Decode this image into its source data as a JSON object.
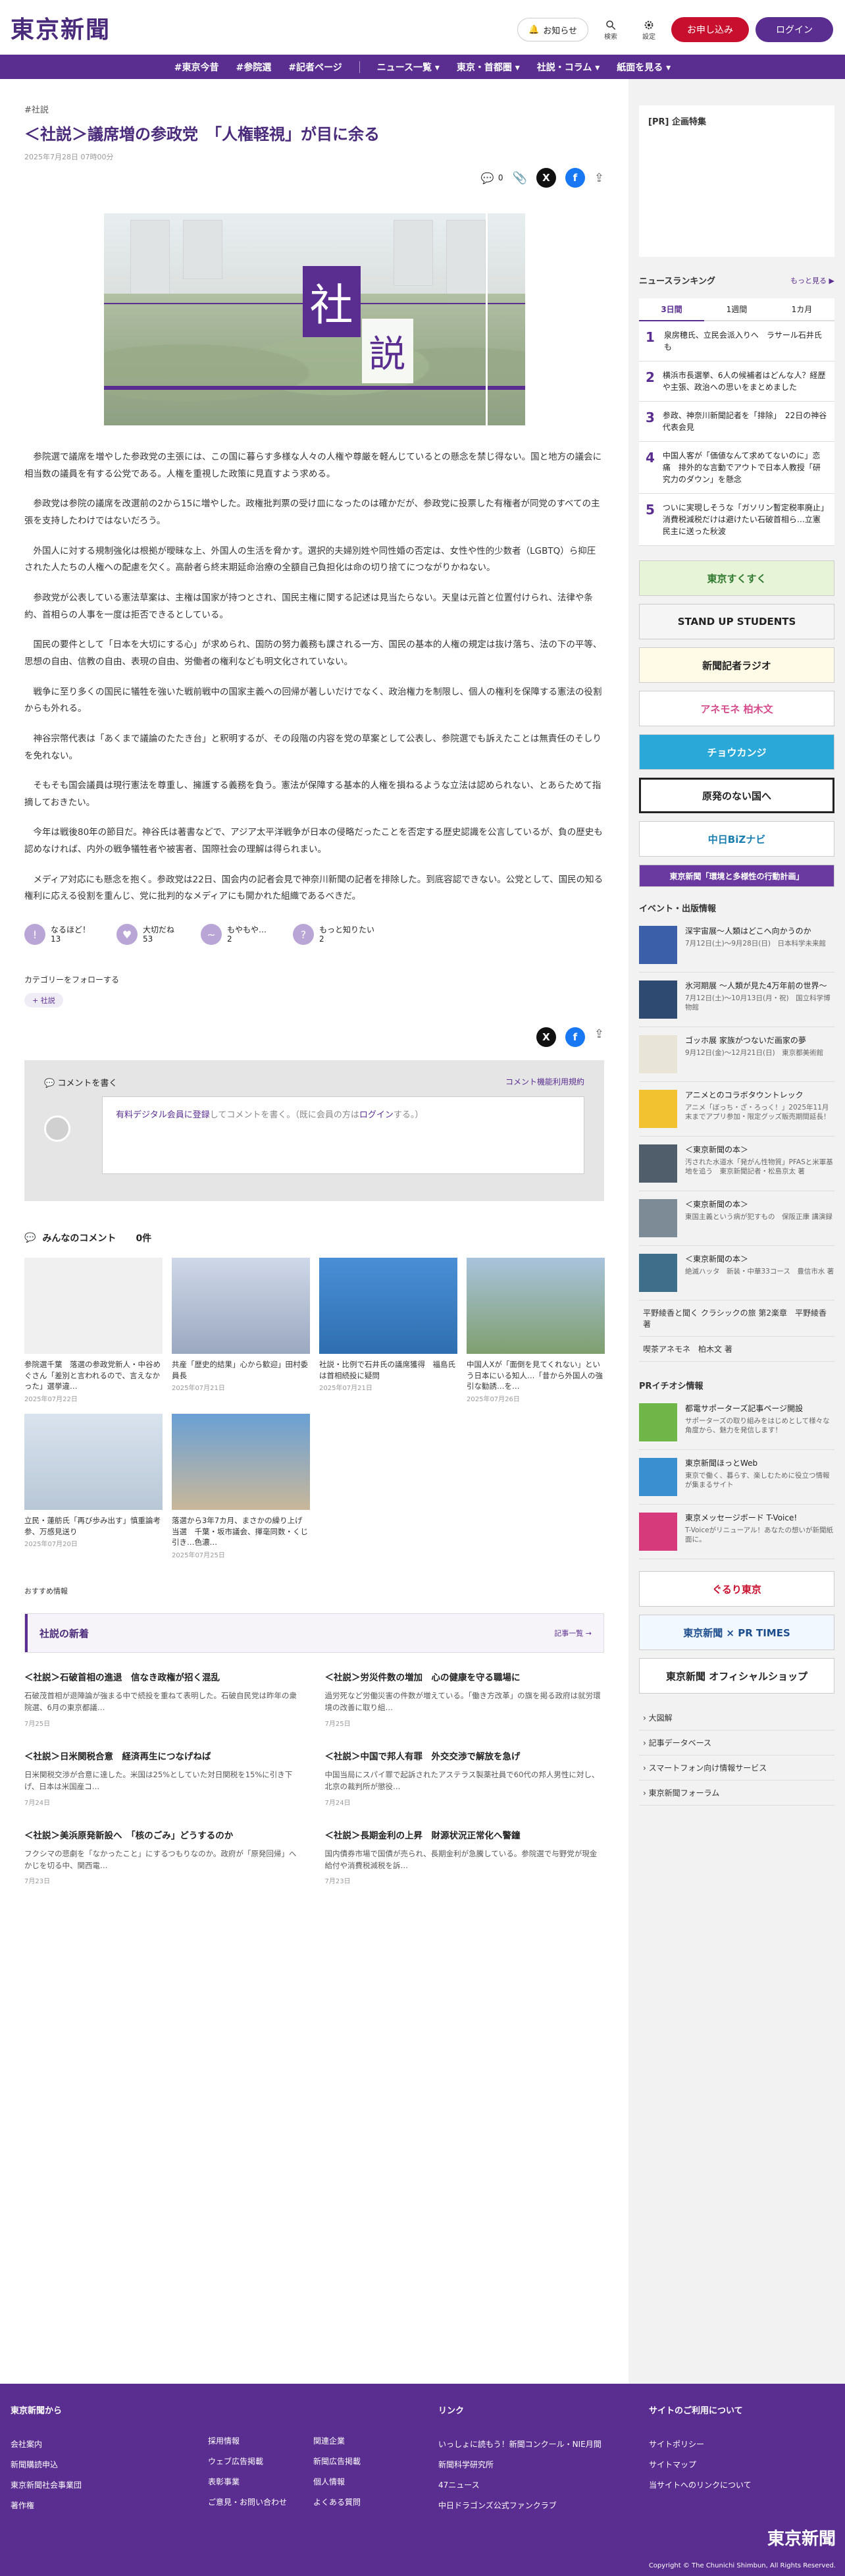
{
  "header": {
    "logo": "東京新聞",
    "notice": "お知らせ",
    "search": "検索",
    "settings": "設定",
    "apply": "お申し込み",
    "login": "ログイン"
  },
  "nav": [
    "#東京今昔",
    "#参院選",
    "#記者ページ",
    "ニュース一覧 ▾",
    "東京・首都圏 ▾",
    "社説・コラム ▾",
    "紙面を見る ▾"
  ],
  "article": {
    "tag": "#社説",
    "title": "＜社説＞議席増の参政党　「人権軽視」が目に余る",
    "date": "2025年7月28日 07時00分",
    "count": "0",
    "hero_kanji_1": "社",
    "hero_kanji_2": "説",
    "paragraphs": [
      "参院選で議席を増やした参政党の主張には、この国に暮らす多様な人々の人権や尊厳を軽んじているとの懸念を禁じ得ない。国と地方の議会に相当数の議員を有する公党である。人権を重視した政策に見直すよう求める。",
      "参政党は参院の議席を改選前の2から15に増やした。政権批判票の受け皿になったのは確かだが、参政党に投票した有権者が同党のすべての主張を支持したわけではないだろう。",
      "外国人に対する規制強化は根拠が曖昧な上、外国人の生活を脅かす。選択的夫婦別姓や同性婚の否定は、女性や性的少数者（LGBTQ）ら抑圧された人たちの人権への配慮を欠く。高齢者ら終末期延命治療の全額自己負担化は命の切り捨てにつながりかねない。",
      "参政党が公表している憲法草案は、主権は国家が持つとされ、国民主権に関する記述は見当たらない。天皇は元首と位置付けられ、法律や条約、首相らの人事を一度は拒否できるとしている。",
      "国民の要件として「日本を大切にする心」が求められ、国防の努力義務も課される一方、国民の基本的人権の規定は抜け落ち、法の下の平等、思想の自由、信教の自由、表現の自由、労働者の権利なども明文化されていない。",
      "戦争に至り多くの国民に犠牲を強いた戦前戦中の国家主義への回帰が著しいだけでなく、政治権力を制限し、個人の権利を保障する憲法の役割からも外れる。",
      "神谷宗幣代表は「あくまで議論のたたき台」と釈明するが、その段階の内容を党の草案として公表し、参院選でも訴えたことは無責任のそしりを免れない。",
      "そもそも国会議員は現行憲法を尊重し、擁護する義務を負う。憲法が保障する基本的人権を損ねるような立法は認められない、とあらためて指摘しておきたい。",
      "今年は戦後80年の節目だ。神谷氏は著書などで、アジア太平洋戦争が日本の侵略だったことを否定する歴史認識を公言しているが、負の歴史も認めなければ、内外の戦争犠牲者や被害者、国際社会の理解は得られまい。",
      "メディア対応にも懸念を抱く。参政党は22日、国会内の記者会見で神奈川新聞の記者を排除した。到底容認できない。公党として、国民の知る権利に応える役割を重んじ、党に批判的なメディアにも開かれた組織であるべきだ。"
    ],
    "reactions": [
      {
        "icon": "!",
        "label": "なるほど！",
        "count": "13"
      },
      {
        "icon": "♥",
        "label": "大切だね",
        "count": "53"
      },
      {
        "icon": "~",
        "label": "もやもや…",
        "count": "2"
      },
      {
        "icon": "?",
        "label": "もっと知りたい",
        "count": "2"
      }
    ],
    "follow_title": "カテゴリーをフォローする",
    "follow_chip": "+ 社説"
  },
  "comment_box": {
    "title": "コメントを書く",
    "guide": "コメント機能利用規約",
    "prompt_link": "有料デジタル会員に登録",
    "prompt_rest": "してコメントを書く。（既に会員の方は",
    "prompt_login": "ログイン",
    "prompt_end": "する。）"
  },
  "comments": {
    "title": "みんなのコメント",
    "count": "0件"
  },
  "related": [
    {
      "caption": "参院選千葉　落選の参政党新人・中谷めぐさん「差別と言われるので、言えなかった」選挙違…",
      "date": "2025年07月22日"
    },
    {
      "caption": "共産「歴史的結果」心から歓迎」田村委員長",
      "date": "2025年07月21日"
    },
    {
      "caption": "社説・比例で石井氏の議席獲得　福島氏は首相続投に疑問",
      "date": "2025年07月21日"
    },
    {
      "caption": "中国人Xが「面倒を見てくれない」という日本にいる知人…「昔から外国人の強引な勧誘…を…",
      "date": "2025年07月26日"
    },
    {
      "caption": "立民・蓮舫氏「再び歩み出す」慎重論考参、万感見送り",
      "date": "2025年07月20日"
    },
    {
      "caption": "落選から3年7カ月、まさかの繰り上げ当選　千葉・坂市議会、揮毫同数・くじ引き…色濃…",
      "date": "2025年07月25日"
    }
  ],
  "recommend": "おすすめ情報",
  "latest": {
    "title": "社説の新着",
    "more": "記事一覧 →",
    "items": [
      {
        "title": "＜社説＞石破首相の進退　信なき政権が招く混乱",
        "summary": "石破茂首相が退陣論が強まる中で続投を重ねて表明した。石破自民党は昨年の衆院選、6月の東京都議…",
        "date": "7月25日"
      },
      {
        "title": "＜社説＞労災件数の増加　心の健康を守る職場に",
        "summary": "過労死など労働災害の件数が増えている。「働き方改革」の旗を掲る政府は就労環境の改善に取り組…",
        "date": "7月25日"
      },
      {
        "title": "＜社説＞日米関税合意　経済再生につなげねば",
        "summary": "日米関税交渉が合意に達した。米国は25%としていた対日関税を15%に引き下げ、日本は米国産コ…",
        "date": "7月24日"
      },
      {
        "title": "＜社説＞中国で邦人有罪　外交交渉で解放を急げ",
        "summary": "中国当局にスパイ罪で起訴されたアステラス製薬社員で60代の邦人男性に対し、北京の裁判所が懲役…",
        "date": "7月24日"
      },
      {
        "title": "＜社説＞美浜原発新設へ　「核のごみ」どうするのか",
        "summary": "フクシマの悲劇を「なかったこと」にするつもりなのか。政府が「原発回帰」へかじを切る中、関西電…",
        "date": "7月23日"
      },
      {
        "title": "＜社説＞長期金利の上昇　財源状況正常化へ警鐘",
        "summary": "国内債券市場で国債が売られ、長期金利が急騰している。参院選で与野党が現金給付や消費税減税を訴…",
        "date": "7月23日"
      }
    ]
  },
  "sidebar": {
    "pr": "[PR] 企画特集",
    "ranking_title": "ニュースランキング",
    "ranking_more": "もっと見る ▶",
    "tabs": [
      "3日間",
      "1週間",
      "1カ月"
    ],
    "ranking": [
      "泉房穂氏、立民会派入りへ　ラサール石井氏も",
      "横浜市長選挙、6人の候補者はどんな人？経歴や主張、政治への思いをまとめました",
      "参政、神奈川新聞記者を「排除」　22日の神谷代表会見",
      "中国人客が「価値なんて求めてないのに」恋痛　排外的な言動でアウトで日本人教授「研究力のダウン」を懸念",
      "ついに実現しそうな「ガソリン暫定税率廃止」消費税減税だけは避けたい石破首相ら…立憲民主に送った秋波"
    ],
    "banners": [
      "東京すくすく",
      "STAND UP STUDENTS",
      "新聞記者ラジオ",
      "アネモネ 柏木文",
      "チョウカンジ",
      "原発のない国へ",
      "中日BiZナビ",
      "東京新聞「環境と多様性の行動計画」"
    ],
    "events_title": "イベント・出版情報",
    "events": [
      {
        "title": "深宇宙展〜人類はどこへ向かうのか",
        "sub": "7月12日(土)〜9月28日(日)　日本科学未来館"
      },
      {
        "title": "氷河期展 〜人類が見た4万年前の世界〜",
        "sub": "7月12日(土)〜10月13日(月・祝)　国立科学博物館"
      },
      {
        "title": "ゴッホ展 家族がつないだ画家の夢",
        "sub": "9月12日(金)〜12月21日(日)　東京都美術館"
      },
      {
        "title": "アニメとのコラボタウントレック",
        "sub": "アニメ「ぼっち・ざ・ろっく！」2025年11月末までアプリ参加・限定グッズ販売期間延長！"
      },
      {
        "title": "＜東京新聞の本＞",
        "sub": "汚された水道水「発がん性物質」PFASと米軍基地を追う　東京新聞記者・松島京太 著"
      },
      {
        "title": "＜東京新聞の本＞",
        "sub": "東国主義という病が犯すもの　保阪正康 講演録"
      },
      {
        "title": "＜東京新聞の本＞",
        "sub": "絶滅ハッタ　新装・中華33コース　豊信市水 著"
      }
    ],
    "extra_links": [
      "平野綾香と聞く クラシックの旅 第2楽章　平野綾香 著",
      "喫茶アネモネ　柏木文 著"
    ],
    "pr2_title": "PRイチオシ情報",
    "pr2": [
      {
        "title": "都電サポーターズ記事ページ開設",
        "sub": "サポーターズの取り組みをはじめとして様々な角度から、魅力を発信します！"
      },
      {
        "title": "東京新聞ほっとWeb",
        "sub": "東京で働く、暮らす、楽しむために役立つ情報が集まるサイト"
      },
      {
        "title": "東京メッセージボード T-Voice!",
        "sub": "T-Voiceがリニューアル！あなたの想いが新聞紙面に。"
      }
    ],
    "banners2": [
      "ぐるり東京",
      "東京新聞 × PR TIMES",
      "東京新聞 オフィシャルショップ"
    ],
    "links": [
      "大図解",
      "記事データベース",
      "スマートフォン向け情報サービス",
      "東京新聞フォーラム"
    ]
  },
  "footer": {
    "col1_title": "東京新聞から",
    "col1": [
      "会社案内",
      "新聞購読申込",
      "東京新聞社会事業団",
      "著作権"
    ],
    "col2": [
      "採用情報",
      "ウェブ広告掲載",
      "表彰事業",
      "ご意見・お問い合わせ"
    ],
    "col3": [
      "関連企業",
      "新聞広告掲載",
      "個人情報",
      "よくある質問"
    ],
    "col4_title": "リンク",
    "col4": [
      "いっしょに読もう！新聞コンクール・NIE月間",
      "新聞科学研究所",
      "47ニュース",
      "中日ドラゴンズ公式ファンクラブ"
    ],
    "col5_title": "サイトのご利用について",
    "col5": [
      "サイトポリシー",
      "サイトマップ",
      "当サイトへのリンクについて"
    ],
    "logo": "東京新聞",
    "copyright": "Copyright © The Chunichi Shimbun, All Rights Reserved."
  }
}
